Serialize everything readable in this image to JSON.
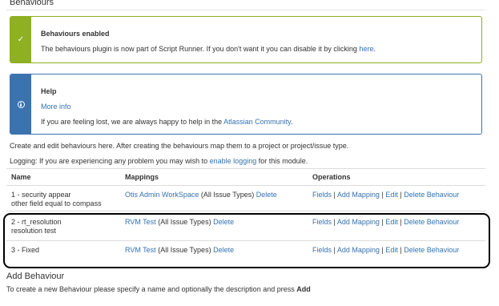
{
  "page_title": "Behaviours",
  "success_message": {
    "title": "Behaviours enabled",
    "text": "The behaviours plugin is now part of Script Runner. If you don't want it you can disable it by clicking",
    "link": "here",
    "end": "."
  },
  "help_message": {
    "title": "Help",
    "more_link": "More info",
    "text": "If you are feeling lost, we are always happy to help in the",
    "link": "Atlassian Community",
    "end": "."
  },
  "intro_text": "Create and edit behaviours here. After creating the behaviours map them to a project or project/issue type.",
  "logging": {
    "text": "Logging: If you are experiencing any problem you may wish to",
    "link": "enable logging",
    "end": "for this module."
  },
  "table": {
    "headers": {
      "name": "Name",
      "mappings": "Mappings",
      "operations": "Operations"
    },
    "rows": [
      {
        "name_line1": "1 - security appear",
        "name_line2": "other field equal to compass",
        "mapping_link": "Otis Admin WorkSpace",
        "mapping_scope": "(All Issue Types)",
        "mapping_delete": "Delete"
      },
      {
        "name_line1": "2 - rt_resolution",
        "name_line2": "resolution test",
        "mapping_link": "RVM Test",
        "mapping_scope": "(All Issue Types)",
        "mapping_delete": "Delete"
      },
      {
        "name_line1": "3 - Fixed",
        "name_line2": "",
        "mapping_link": "RVM Test",
        "mapping_scope": "(All Issue Types)",
        "mapping_delete": "Delete"
      }
    ],
    "operations": {
      "fields": "Fields",
      "add_mapping": "Add Mapping",
      "edit": "Edit",
      "delete_behaviour": "Delete Behaviour",
      "separator": "|"
    }
  },
  "add_behaviour": {
    "title": "Add Behaviour",
    "help_text": "To create a new Behaviour please specify a name and optionally the description and press",
    "help_bold": "Add"
  },
  "colors": {
    "success": "#8eb021",
    "info": "#3b73af",
    "link": "#3572b0"
  },
  "icons": {
    "success": "check-icon",
    "info": "info-icon"
  }
}
